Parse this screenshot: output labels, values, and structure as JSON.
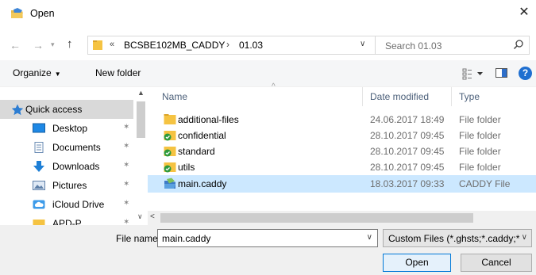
{
  "window": {
    "title": "Open"
  },
  "address": {
    "chevron": "«",
    "segment1": "BCSBE102MB_CADDY",
    "separator": "›",
    "segment2": "01.03"
  },
  "search": {
    "placeholder": "Search 01.03"
  },
  "toolbar": {
    "organize": "Organize",
    "new_folder": "New folder",
    "help": "?"
  },
  "navigation": {
    "items": [
      {
        "label": "Quick access",
        "icon": "star-icon",
        "pinned": false,
        "selected": true
      },
      {
        "label": "Desktop",
        "icon": "desktop-icon",
        "pinned": true
      },
      {
        "label": "Documents",
        "icon": "documents-icon",
        "pinned": true
      },
      {
        "label": "Downloads",
        "icon": "downloads-icon",
        "pinned": true
      },
      {
        "label": "Pictures",
        "icon": "pictures-icon",
        "pinned": true
      },
      {
        "label": "iCloud Drive",
        "icon": "cloud-icon",
        "pinned": true
      },
      {
        "label": "APD-P",
        "icon": "folder-icon",
        "pinned": true
      }
    ]
  },
  "files": {
    "columns": {
      "name": "Name",
      "date": "Date modified",
      "type": "Type"
    },
    "rows": [
      {
        "name": "additional-files",
        "date": "24.06.2017 18:49",
        "type": "File folder",
        "icon": "folder-icon"
      },
      {
        "name": "confidential",
        "date": "28.10.2017 09:45",
        "type": "File folder",
        "icon": "synced-folder-icon"
      },
      {
        "name": "standard",
        "date": "28.10.2017 09:45",
        "type": "File folder",
        "icon": "synced-folder-icon"
      },
      {
        "name": "utils",
        "date": "28.10.2017 09:45",
        "type": "File folder",
        "icon": "synced-folder-icon"
      },
      {
        "name": "main.caddy",
        "date": "18.03.2017 09:33",
        "type": "CADDY File",
        "icon": "caddy-file-icon",
        "selected": true
      }
    ]
  },
  "footer": {
    "file_name_label": "File name:",
    "file_name_value": "main.caddy",
    "filter_value": "Custom Files (*.ghsts;*.caddy;*.",
    "open_label": "Open",
    "cancel_label": "Cancel"
  },
  "colors": {
    "selection": "#cce8ff",
    "accent": "#0078d7",
    "folder": "#f5c342"
  }
}
